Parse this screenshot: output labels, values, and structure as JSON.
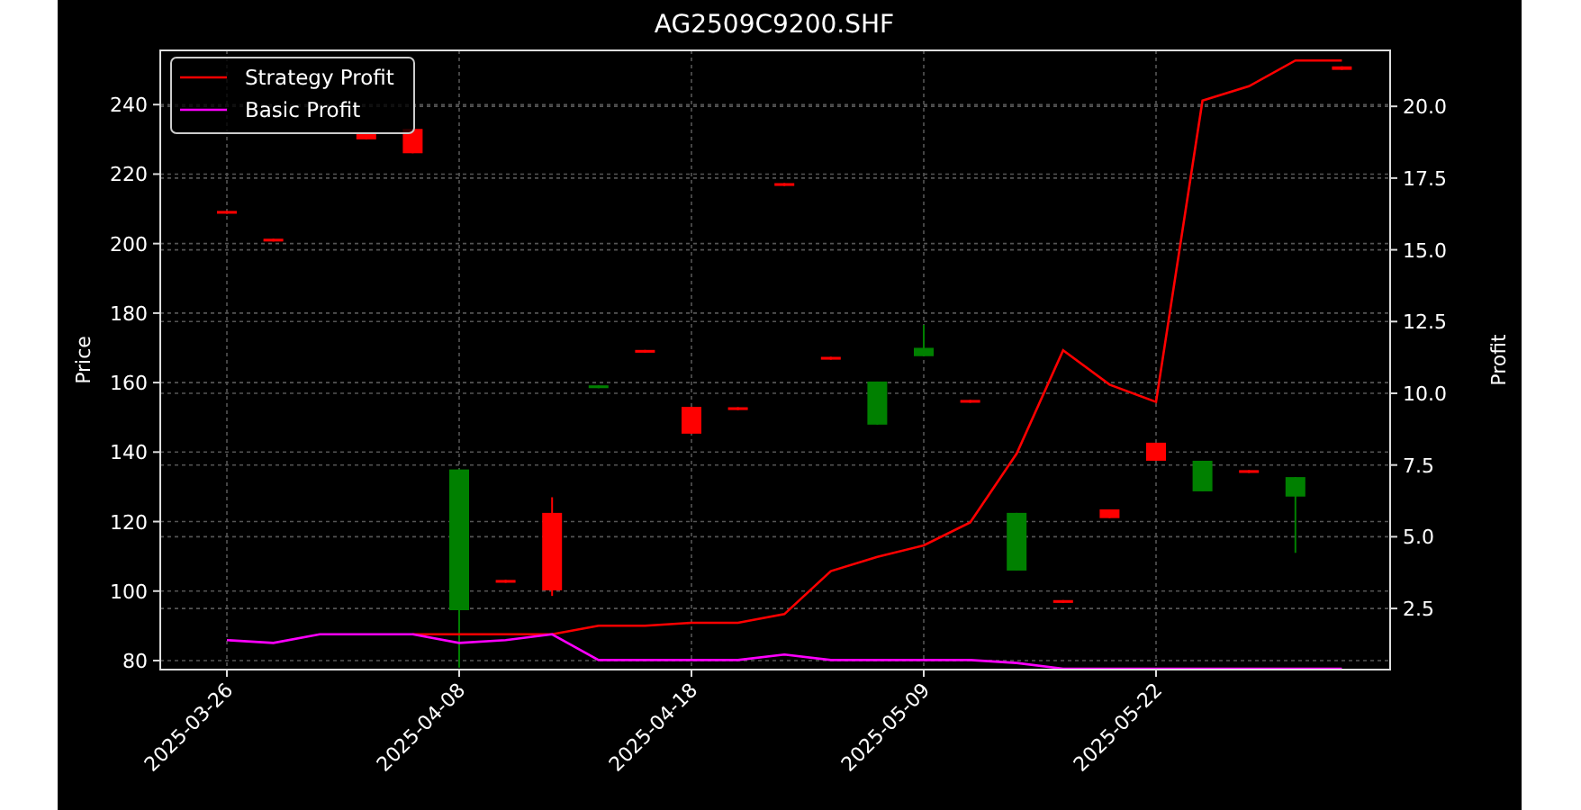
{
  "chart_data": {
    "type": "line",
    "title": "AG2509C9200.SHF",
    "ylabel": "Price",
    "y2label": "Profit",
    "grid": true,
    "legend": true,
    "categories": [
      "2025-03-26",
      null,
      null,
      null,
      null,
      "2025-04-08",
      null,
      null,
      null,
      null,
      "2025-04-18",
      null,
      null,
      null,
      null,
      "2025-05-09",
      null,
      null,
      null,
      null,
      "2025-05-22",
      null,
      null,
      null,
      null
    ],
    "ylim": [
      77.4,
      255.6
    ],
    "y2lim": [
      0.37,
      21.95
    ],
    "yticks": [
      80,
      100,
      120,
      140,
      160,
      180,
      200,
      220,
      240
    ],
    "y2ticks": [
      {
        "value": 2.5,
        "label": "2.5"
      },
      {
        "value": 5,
        "label": "5.0"
      },
      {
        "value": 7.5,
        "label": "7.5"
      },
      {
        "value": 10,
        "label": "10.0"
      },
      {
        "value": 12.5,
        "label": "12.5"
      },
      {
        "value": 15,
        "label": "15.0"
      },
      {
        "value": 17.5,
        "label": "17.5"
      },
      {
        "value": 20,
        "label": "20.0"
      }
    ],
    "series": [
      {
        "name": "Strategy Profit",
        "color": "#ff0000",
        "axis": "y2",
        "values": [
          null,
          null,
          null,
          null,
          1.6,
          1.6,
          1.6,
          1.6,
          1.9,
          1.9,
          2.0,
          2.0,
          2.3,
          3.8,
          4.3,
          4.7,
          5.5,
          7.9,
          11.5,
          10.3,
          9.7,
          20.2,
          20.7,
          21.6,
          21.6
        ]
      },
      {
        "name": "Basic Profit",
        "color": "#ff00ff",
        "axis": "y2",
        "values": [
          1.4,
          1.3,
          1.6,
          1.6,
          1.6,
          1.3,
          1.4,
          1.6,
          0.7,
          0.7,
          0.7,
          0.7,
          0.9,
          0.7,
          0.7,
          0.7,
          0.7,
          0.6,
          0.4,
          0.4,
          0.4,
          0.4,
          0.4,
          0.4,
          0.4
        ]
      },
      {
        "type": "candlestick",
        "ohlc": [
          [
            208.6,
            209.4,
            208.6,
            209.4
          ],
          [
            200.6,
            201.4,
            200.6,
            201.4
          ],
          null,
          [
            230,
            232,
            230,
            232
          ],
          [
            226,
            233,
            226,
            233
          ],
          [
            135,
            135,
            78,
            94.5
          ],
          [
            102.4,
            103.2,
            102.4,
            103.2
          ],
          [
            100.2,
            127,
            98.6,
            122.5
          ],
          [
            159.2,
            159.2,
            158.4,
            158.4
          ],
          [
            168.6,
            169.4,
            168.6,
            169.4
          ],
          [
            145.3,
            153,
            145.3,
            153
          ],
          [
            152.1,
            152.9,
            152.1,
            152.9
          ],
          [
            216.6,
            217.4,
            216.6,
            217.4
          ],
          [
            166.6,
            167.4,
            166.6,
            167.4
          ],
          [
            160.3,
            160.3,
            147.9,
            147.9
          ],
          [
            170,
            176.6,
            167.6,
            167.6
          ],
          [
            154.2,
            155,
            154.2,
            155
          ],
          [
            122.5,
            122.5,
            105.9,
            105.9
          ],
          [
            96.6,
            97.4,
            96.6,
            97.4
          ],
          [
            121,
            123.5,
            121,
            123.5
          ],
          [
            137.5,
            142.7,
            137.5,
            142.7
          ],
          [
            137.5,
            137.5,
            128.7,
            128.7
          ],
          [
            134,
            134.8,
            134,
            134.8
          ],
          [
            132.8,
            132.8,
            111,
            127.2
          ],
          [
            250,
            251,
            250,
            251
          ]
        ]
      }
    ]
  }
}
